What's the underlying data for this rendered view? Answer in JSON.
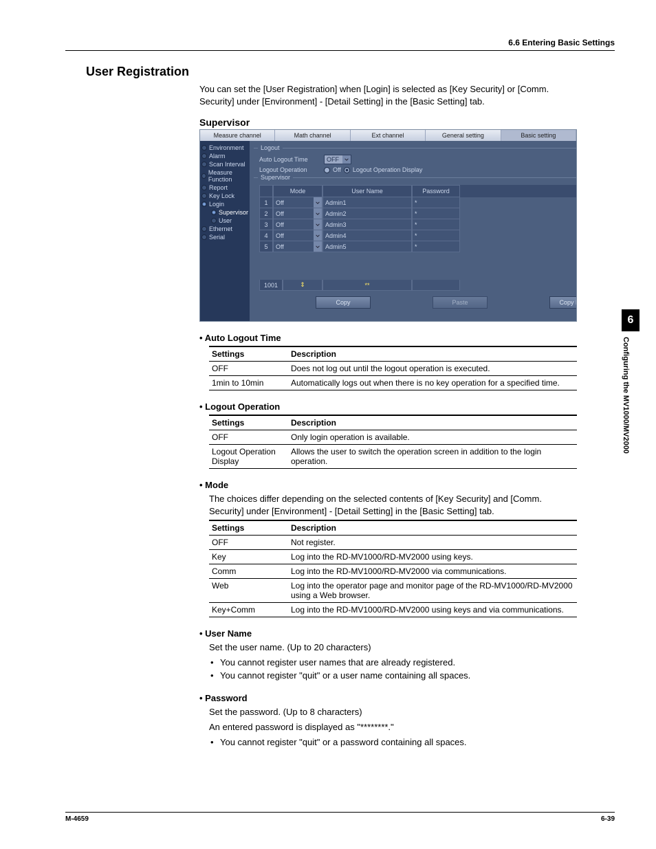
{
  "header": {
    "section": "6.6  Entering Basic Settings"
  },
  "title": "User Registration",
  "intro": "You can set the [User Registration] when [Login] is selected as [Key Security] or [Comm. Security] under [Environment] - [Detail Setting] in the [Basic Setting] tab.",
  "supervisor_heading": "Supervisor",
  "screenshot": {
    "tabs": [
      "Measure channel",
      "Math channel",
      "Ext channel",
      "General setting",
      "Basic setting"
    ],
    "selected_tab": 4,
    "sidebar": [
      {
        "label": "Environment"
      },
      {
        "label": "Alarm"
      },
      {
        "label": "Scan Interval"
      },
      {
        "label": "Measure Function"
      },
      {
        "label": "Report"
      },
      {
        "label": "Key Lock"
      },
      {
        "label": "Login",
        "on": true
      },
      {
        "label": "Supervisor",
        "indent": true,
        "sel": true
      },
      {
        "label": "User",
        "indent": true
      },
      {
        "label": "Ethernet"
      },
      {
        "label": "Serial"
      }
    ],
    "logout_group": "Logout",
    "auto_logout_label": "Auto Logout Time",
    "auto_logout_value": "OFF",
    "logout_op_label": "Logout Operation",
    "logout_op_opt1": "Off",
    "logout_op_opt2": "Logout Operation Display",
    "supervisor_group": "Supervisor",
    "cols": {
      "mode": "Mode",
      "user": "User Name",
      "pass": "Password"
    },
    "rows": [
      {
        "n": "1",
        "mode": "Off",
        "user": "Admin1",
        "pass": "*"
      },
      {
        "n": "2",
        "mode": "Off",
        "user": "Admin2",
        "pass": "*"
      },
      {
        "n": "3",
        "mode": "Off",
        "user": "Admin3",
        "pass": "*"
      },
      {
        "n": "4",
        "mode": "Off",
        "user": "Admin4",
        "pass": "*"
      },
      {
        "n": "5",
        "mode": "Off",
        "user": "Admin5",
        "pass": "*"
      }
    ],
    "bottom_row_num": "1001",
    "bottom_row_user": "**",
    "btn_copy": "Copy",
    "btn_paste": "Paste",
    "btn_copy_details": "Copy Details"
  },
  "sections": {
    "auto_logout": {
      "title": "Auto Logout Time",
      "head_settings": "Settings",
      "head_desc": "Description",
      "rows": [
        {
          "s": "OFF",
          "d": "Does not log out until the logout operation is executed."
        },
        {
          "s": "1min to 10min",
          "d": "Automatically logs out when there is no key operation for a specified time."
        }
      ]
    },
    "logout_op": {
      "title": "Logout Operation",
      "head_settings": "Settings",
      "head_desc": "Description",
      "rows": [
        {
          "s": "OFF",
          "d": "Only login operation is available."
        },
        {
          "s": "Logout Operation Display",
          "d": "Allows the user to switch the operation screen in addition to the login operation."
        }
      ]
    },
    "mode": {
      "title": "Mode",
      "intro": "The choices differ depending on the selected contents of [Key Security] and [Comm. Security] under [Environment] - [Detail Setting] in the [Basic Setting] tab.",
      "head_settings": "Settings",
      "head_desc": "Description",
      "rows": [
        {
          "s": "OFF",
          "d": "Not register."
        },
        {
          "s": "Key",
          "d": "Log into the RD-MV1000/RD-MV2000 using keys."
        },
        {
          "s": "Comm",
          "d": "Log into the RD-MV1000/RD-MV2000 via communications."
        },
        {
          "s": "Web",
          "d": "Log into the operator page and monitor page of the RD-MV1000/RD-MV2000 using a Web browser."
        },
        {
          "s": "Key+Comm",
          "d": "Log into the RD-MV1000/RD-MV2000 using keys and via communications."
        }
      ]
    },
    "user_name": {
      "title": "User Name",
      "para": "Set the user name.  (Up to 20 characters)",
      "bullets": [
        "You cannot register user names that are already registered.",
        "You cannot register \"quit\" or a user name containing all spaces."
      ]
    },
    "password": {
      "title": "Password",
      "para1": "Set the password.  (Up to 8 characters)",
      "para2": "An entered password is displayed as \"********.\"",
      "bullets": [
        "You cannot register \"quit\" or a password containing all spaces."
      ]
    }
  },
  "side_tab": {
    "num": "6",
    "text": "Configuring the MV1000/MV2000"
  },
  "footer": {
    "left": "M-4659",
    "right": "6-39"
  }
}
